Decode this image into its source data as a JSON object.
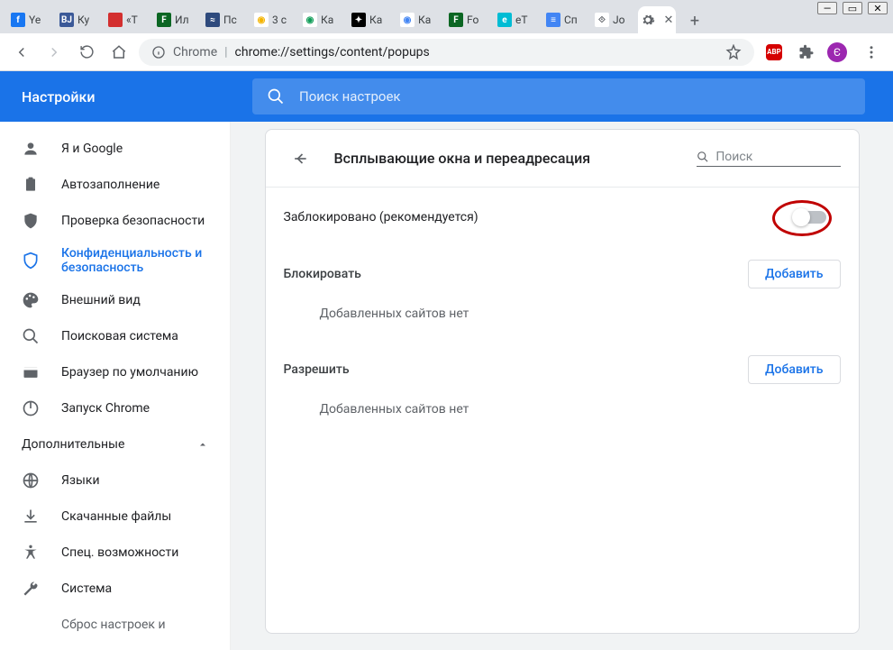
{
  "tabs": [
    {
      "title": "Ye",
      "favicon_bg": "#1877f2",
      "favicon_text": "f",
      "favicon_fg": "#fff"
    },
    {
      "title": "Ку",
      "favicon_bg": "#3b5998",
      "favicon_text": "ВЈ",
      "favicon_fg": "#fff"
    },
    {
      "title": "«Т",
      "favicon_bg": "#d32f2f",
      "favicon_text": "",
      "favicon_fg": "#fff"
    },
    {
      "title": "Ил",
      "favicon_bg": "#0b6623",
      "favicon_text": "F",
      "favicon_fg": "#fff"
    },
    {
      "title": "Пс",
      "favicon_bg": "#2e4a7d",
      "favicon_text": "≈",
      "favicon_fg": "#fff"
    },
    {
      "title": "3 с",
      "favicon_bg": "#fff",
      "favicon_text": "◉",
      "favicon_fg": "#f4b400"
    },
    {
      "title": "Ка",
      "favicon_bg": "#fff",
      "favicon_text": "◉",
      "favicon_fg": "#0f9d58"
    },
    {
      "title": "Ка",
      "favicon_bg": "#000",
      "favicon_text": "✦",
      "favicon_fg": "#fff"
    },
    {
      "title": "Ка",
      "favicon_bg": "#fff",
      "favicon_text": "◉",
      "favicon_fg": "#4285f4"
    },
    {
      "title": "Fo",
      "favicon_bg": "#0b6623",
      "favicon_text": "F",
      "favicon_fg": "#fff"
    },
    {
      "title": "eT",
      "favicon_bg": "#00bcd4",
      "favicon_text": "e",
      "favicon_fg": "#fff"
    },
    {
      "title": "Сп",
      "favicon_bg": "#4285f4",
      "favicon_text": "≡",
      "favicon_fg": "#fff"
    },
    {
      "title": "Jo",
      "favicon_bg": "#fff",
      "favicon_text": "⟐",
      "favicon_fg": "#5f6368"
    }
  ],
  "active_tab_close": "✕",
  "omnibox": {
    "chrome_label": "Chrome",
    "url": "chrome://settings/content/popups"
  },
  "avatar_letter": "Є",
  "settings_title": "Настройки",
  "search_placeholder": "Поиск настроек",
  "sidebar": {
    "items": [
      {
        "label": "Я и Google"
      },
      {
        "label": "Автозаполнение"
      },
      {
        "label": "Проверка безопасности"
      },
      {
        "label": "Конфиденциальность и безопасность"
      },
      {
        "label": "Внешний вид"
      },
      {
        "label": "Поисковая система"
      },
      {
        "label": "Браузер по умолчанию"
      },
      {
        "label": "Запуск Chrome"
      }
    ],
    "advanced": "Дополнительные",
    "adv_items": [
      {
        "label": "Языки"
      },
      {
        "label": "Скачанные файлы"
      },
      {
        "label": "Спец. возможности"
      },
      {
        "label": "Система"
      },
      {
        "label": "Сброс настроек и"
      }
    ]
  },
  "card": {
    "title": "Всплывающие окна и переадресация",
    "search_placeholder": "Поиск",
    "blocked_label": "Заблокировано (рекомендуется)",
    "block_section": "Блокировать",
    "allow_section": "Разрешить",
    "add_button": "Добавить",
    "empty_text": "Добавленных сайтов нет"
  }
}
